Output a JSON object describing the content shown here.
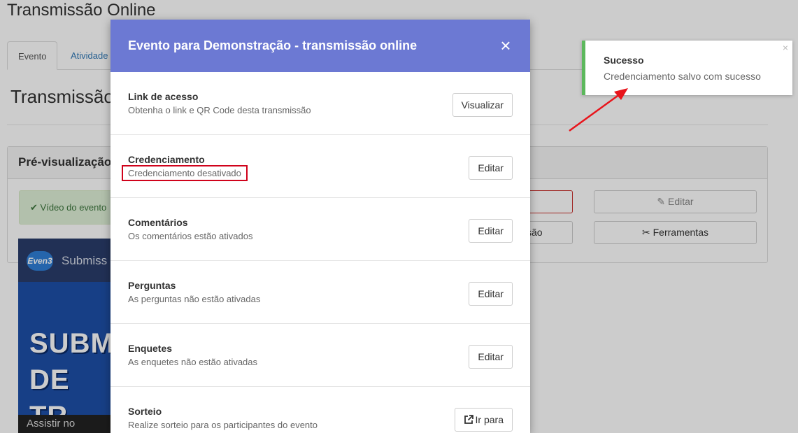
{
  "page": {
    "title": "Transmissão Online",
    "tabs": [
      "Evento",
      "Atividade"
    ],
    "section_title": "Transmissão",
    "panel_title": "Pré-visualização",
    "alert": "Vídeo do evento",
    "buttons": {
      "editar": "Editar",
      "transmissao": "ssão",
      "ferramentas": "Ferramentas"
    },
    "thumbnail": {
      "logo": "Even3",
      "subtitle": "Submiss",
      "big_line1": "SUBM",
      "big_line2": "DE TR",
      "bottom": "Assistir no"
    }
  },
  "modal": {
    "title": "Evento para Demonstração - transmissão online",
    "close_label": "×",
    "rows": [
      {
        "title": "Link de acesso",
        "desc": "Obtenha o link e QR Code desta transmissão",
        "button": "Visualizar"
      },
      {
        "title": "Credenciamento",
        "desc": "Credenciamento desativado",
        "button": "Editar"
      },
      {
        "title": "Comentários",
        "desc": "Os comentários estão ativados",
        "button": "Editar"
      },
      {
        "title": "Perguntas",
        "desc": "As perguntas não estão ativadas",
        "button": "Editar"
      },
      {
        "title": "Enquetes",
        "desc": "As enquetes não estão ativadas",
        "button": "Editar"
      },
      {
        "title": "Sorteio",
        "desc": "Realize sorteio para os participantes do evento",
        "button": "Ir para"
      }
    ]
  },
  "toast": {
    "title": "Sucesso",
    "message": "Credenciamento salvo com sucesso",
    "close_label": "×",
    "accent": "#5cb85c"
  },
  "colors": {
    "modal_header": "#6c79d3",
    "highlight": "#d0021b"
  }
}
